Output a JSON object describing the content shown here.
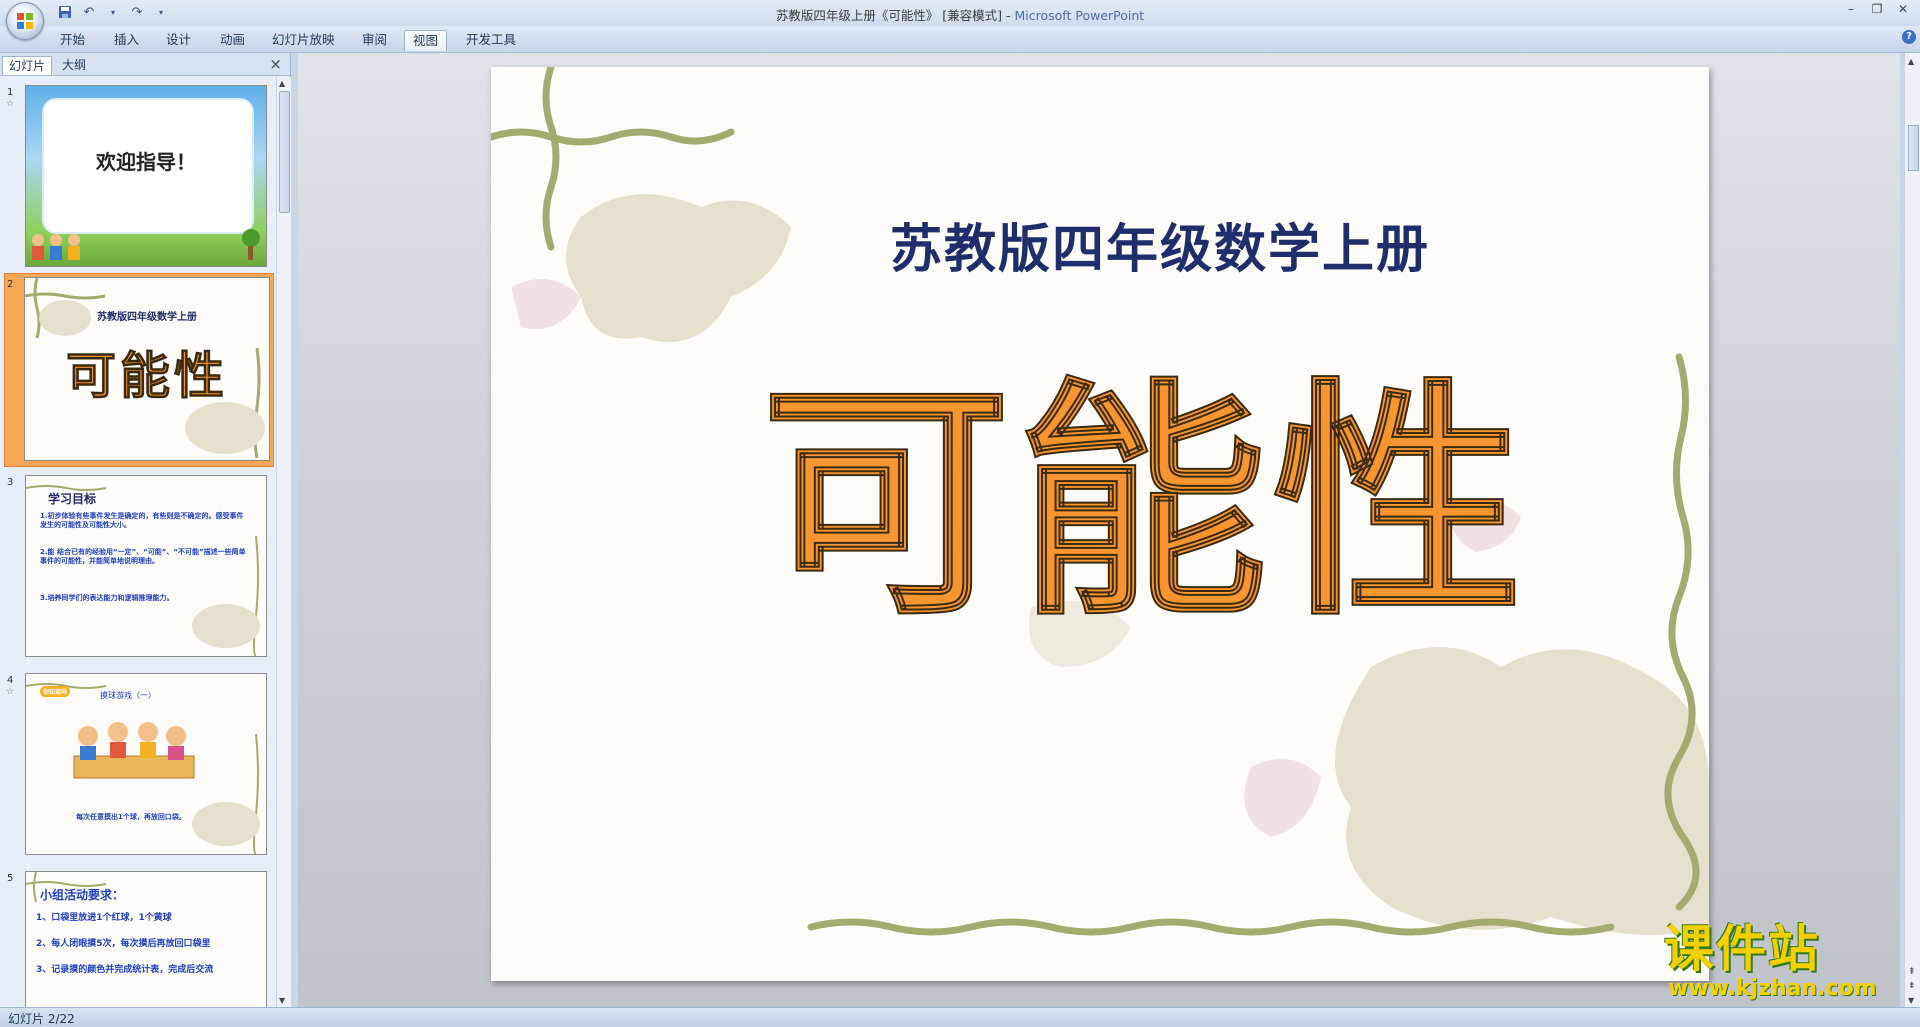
{
  "window": {
    "title": "苏教版四年级上册《可能性》 [兼容模式] - ",
    "app_name": "Microsoft PowerPoint"
  },
  "ribbon_tabs": [
    "开始",
    "插入",
    "设计",
    "动画",
    "幻灯片放映",
    "审阅",
    "视图",
    "开发工具"
  ],
  "active_tab": "视图",
  "left_pane": {
    "tabs": [
      "幻灯片",
      "大纲"
    ],
    "close_glyph": "×"
  },
  "thumbnails": [
    {
      "num": "1",
      "text": "欢迎指导！"
    },
    {
      "num": "2",
      "subtitle": "苏教版四年级数学上册",
      "title": "可能性"
    },
    {
      "num": "3",
      "heading": "学习目标",
      "lines": [
        "1.初步体验有些事件发生是确定的，有些则是不确定的。感受事件发生的可能性及可能性大小。",
        "2.能 结合已有的经验用“一定”、“可能”、“不可能”描述一些简单事件的可能性，并能简单地说明理由。",
        "3.培养同学们的表达能力和逻辑推理能力。"
      ]
    },
    {
      "num": "4",
      "badge": "你知道吗",
      "heading": "摸球游戏（一）",
      "caption": "每次任意摸出1个球，再放回口袋。"
    },
    {
      "num": "5",
      "heading": "小组活动要求：",
      "lines": [
        "1、口袋里放进1个红球，1个黄球",
        "2、每人闭眼摸5次，每次摸后再放回口袋里",
        "3、记录摸的颜色并完成统计表，完成后交流"
      ]
    }
  ],
  "slide": {
    "subtitle": "苏教版四年级数学上册",
    "title": "可能性"
  },
  "status": {
    "text": "幻灯片 2/22"
  },
  "watermark": {
    "big": "课件站",
    "url": "www.kjzhan.com"
  },
  "colors": {
    "title_orange": "#f7962f",
    "subtitle_navy": "#1f2d6b",
    "decor_olive": "#a4ab6e",
    "blob_beige": "#e6e1cf"
  }
}
